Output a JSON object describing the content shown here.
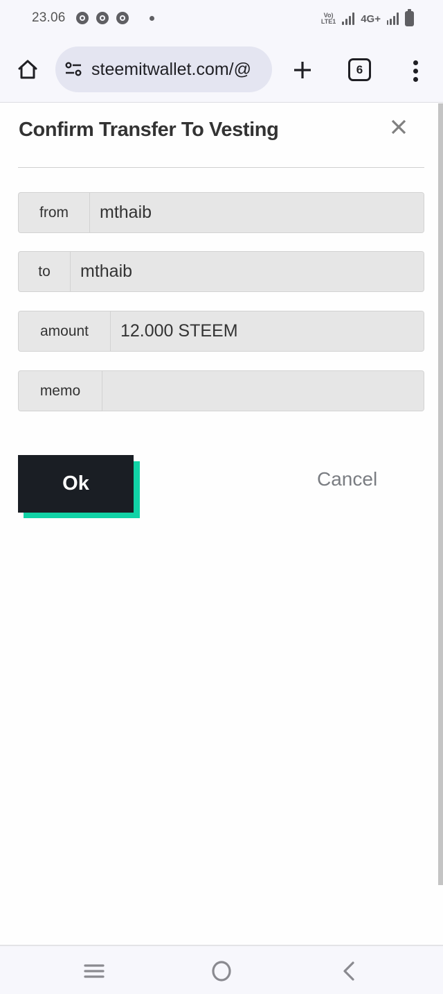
{
  "status_bar": {
    "time": "23.06",
    "notification_icons": [
      "chrome-icon",
      "chrome-icon",
      "chrome-icon"
    ],
    "volte_label_top": "Vo)",
    "volte_label_bottom": "LTE1",
    "network_type": "4G+",
    "battery": "battery-icon"
  },
  "browser": {
    "url": "steemitwallet.com/@",
    "tab_count": "6",
    "icons": {
      "home": "home-icon",
      "site_settings": "tune-icon",
      "new_tab": "plus-icon",
      "menu": "more-vert-icon"
    }
  },
  "dialog": {
    "title": "Confirm Transfer To Vesting",
    "close_icon": "close-icon",
    "fields": [
      {
        "label": "from",
        "value": "mthaib"
      },
      {
        "label": "to",
        "value": "mthaib"
      },
      {
        "label": "amount",
        "value": "12.000 STEEM"
      },
      {
        "label": "memo",
        "value": ""
      }
    ],
    "ok_label": "Ok",
    "cancel_label": "Cancel",
    "colors": {
      "ok_background": "#1a1e24",
      "ok_accent": "#11d3a6",
      "cancel_text": "#7a7d82"
    }
  },
  "nav_bar": {
    "buttons": [
      "recents-icon",
      "home-circle-icon",
      "back-icon"
    ]
  }
}
